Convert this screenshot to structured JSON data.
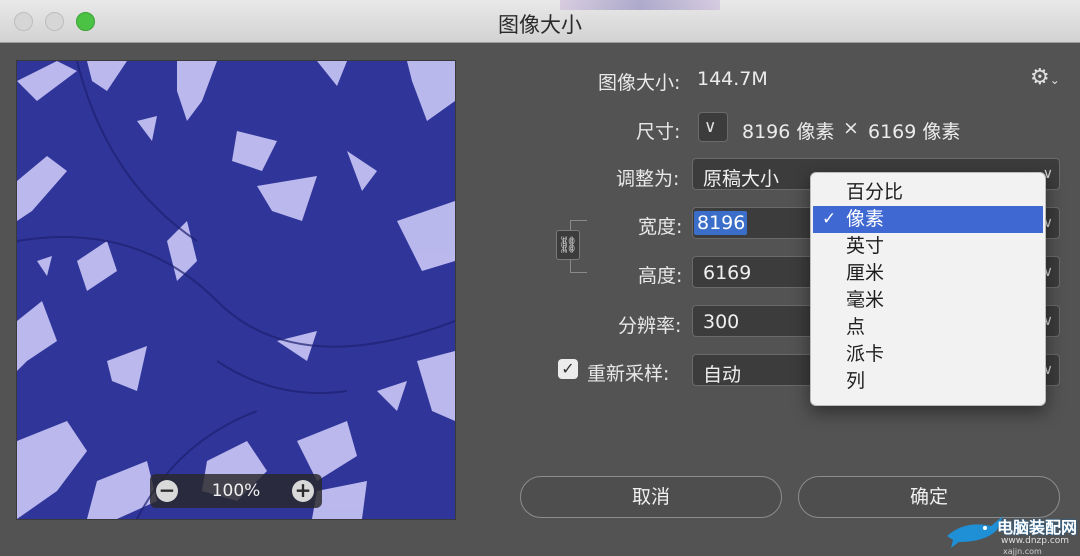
{
  "window": {
    "title": "图像大小"
  },
  "preview": {
    "zoom_level": "100%"
  },
  "info": {
    "image_size_label": "图像大小:",
    "image_size_value": "144.7M",
    "dimensions_label": "尺寸:",
    "dimensions_width": "8196 像素",
    "dimensions_times": "×",
    "dimensions_height": "6169 像素"
  },
  "form": {
    "fit_to": {
      "label": "调整为:",
      "value": "原稿大小"
    },
    "width": {
      "label": "宽度:",
      "value": "8196"
    },
    "height": {
      "label": "高度:",
      "value": "6169"
    },
    "resolution": {
      "label": "分辨率:",
      "value": "300"
    },
    "resample": {
      "label": "重新采样:",
      "checked": true,
      "value": "自动"
    }
  },
  "unit_menu": {
    "items": [
      "百分比",
      "像素",
      "英寸",
      "厘米",
      "毫米",
      "点",
      "派卡",
      "列"
    ],
    "selected_index": 1
  },
  "buttons": {
    "cancel": "取消",
    "ok": "确定"
  },
  "watermark": {
    "text": "电脑装配网",
    "url": "www.dnzp.com",
    "url2": "xajjn.com"
  },
  "colors": {
    "accent": "#3f68d2",
    "preview": "#2a2f8f",
    "zoom_green": "#4cc245"
  }
}
